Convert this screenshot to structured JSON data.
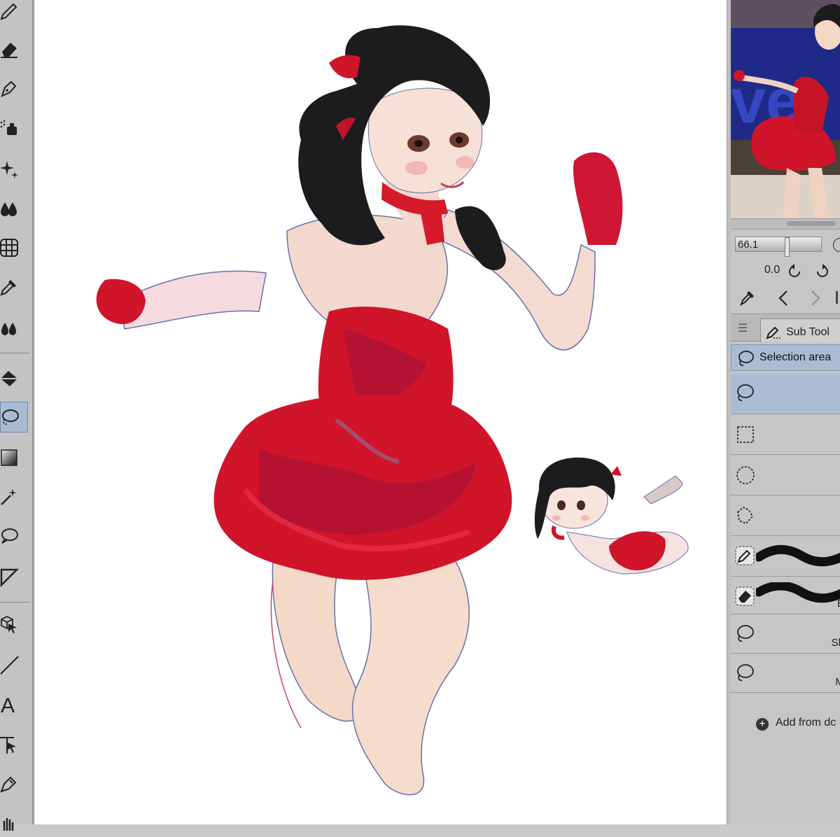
{
  "navigator": {
    "zoom_value": "66.1",
    "rotation_value": "0.0"
  },
  "subtool_panel": {
    "tab_label": "Sub Tool",
    "group_label": "Selection area",
    "items": [
      {
        "label": ""
      },
      {
        "label": ""
      },
      {
        "label": ""
      },
      {
        "label": ""
      },
      {
        "label": ""
      },
      {
        "label": "E"
      },
      {
        "label": "Sh"
      },
      {
        "label": "M"
      }
    ],
    "add_label": "Add from dc"
  },
  "toolbar": {
    "tools": [
      "pencil-icon",
      "eraser-icon",
      "pen-nib-icon",
      "airbrush-icon",
      "sparkle-icon",
      "blend-icon",
      "mesh-icon",
      "eyedropper-icon",
      "drops-icon",
      "fill-bucket-icon",
      "lasso-selection-icon",
      "gradient-icon",
      "magic-wand-icon",
      "balloon-icon",
      "ruler-icon",
      "3d-object-icon",
      "line-icon",
      "text-icon",
      "move-icon",
      "correct-line-icon"
    ],
    "active_tool": "lasso-selection-icon"
  },
  "colors": {
    "ui_gray": "#c6c6c6",
    "selection_blue": "#a9bcd3",
    "dress_red": "#d0142a",
    "skin": "#f6ddd2"
  }
}
